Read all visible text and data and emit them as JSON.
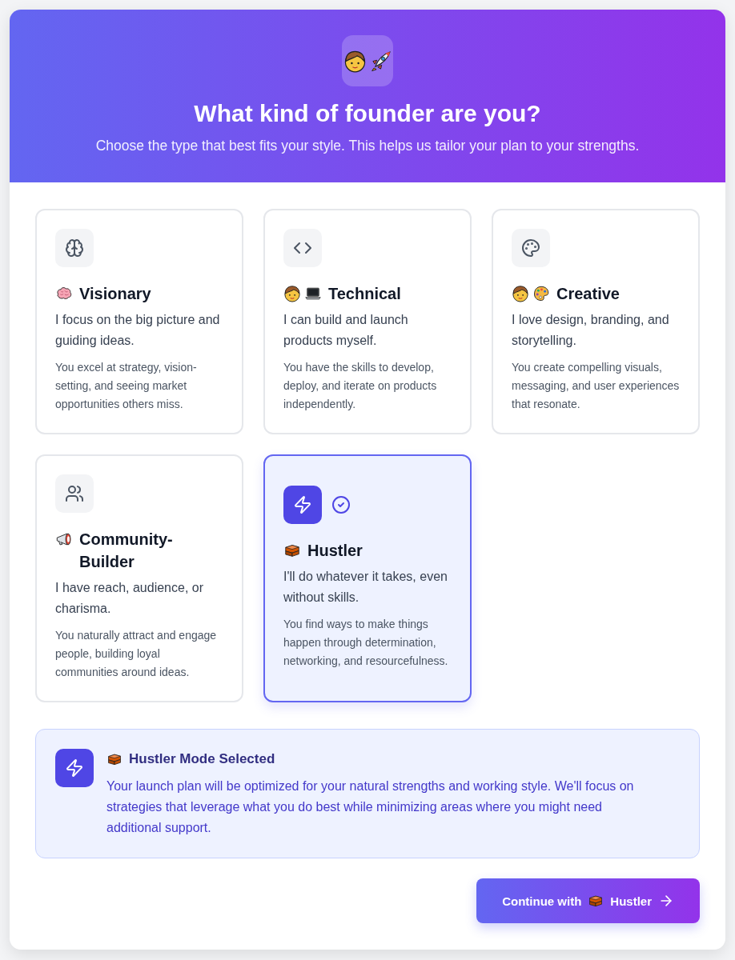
{
  "header": {
    "title": "What kind of founder are you?",
    "subtitle": "Choose the type that best fits your style. This helps us tailor your plan to your strengths."
  },
  "cards": [
    {
      "title": "Visionary",
      "tagline": "I focus on the big picture and guiding ideas.",
      "description": "You excel at strategy, vision-setting, and seeing market opportunities others miss.",
      "selected": false
    },
    {
      "title": "Technical",
      "tagline": "I can build and launch products myself.",
      "description": "You have the skills to develop, deploy, and iterate on products independently.",
      "selected": false
    },
    {
      "title": "Creative",
      "tagline": "I love design, branding, and storytelling.",
      "description": "You create compelling visuals, messaging, and user experiences that resonate.",
      "selected": false
    },
    {
      "title": "Community-Builder",
      "tagline": "I have reach, audience, or charisma.",
      "description": "You naturally attract and engage people, building loyal communities around ideas.",
      "selected": false
    },
    {
      "title": "Hustler",
      "tagline": "I'll do whatever it takes, even without skills.",
      "description": "You find ways to make things happen through determination, networking, and resourcefulness.",
      "selected": true
    }
  ],
  "summary": {
    "title": "Hustler Mode Selected",
    "body": "Your launch plan will be optimized for your natural strengths and working style. We'll focus on strategies that leverage what you do best while minimizing areas where you might need additional support."
  },
  "continue_button": {
    "label_start": "Continue with",
    "label_end": "Hustler"
  }
}
